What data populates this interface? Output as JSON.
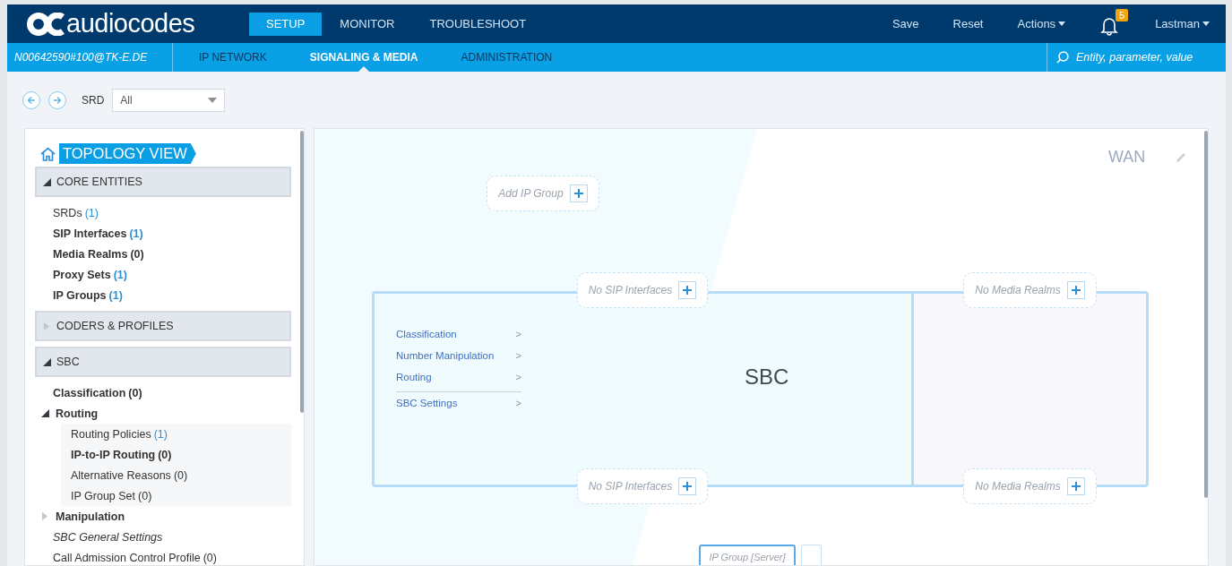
{
  "brand": {
    "name": "audiocodes"
  },
  "top_tabs": [
    {
      "label": "SETUP",
      "selected": true
    },
    {
      "label": "MONITOR",
      "selected": false
    },
    {
      "label": "TROUBLESHOOT",
      "selected": false
    }
  ],
  "top_actions": [
    {
      "label": "Save",
      "kind": "plain"
    },
    {
      "label": "Reset",
      "kind": "plain"
    },
    {
      "label": "Actions",
      "kind": "menu"
    }
  ],
  "notifications": {
    "count": "5"
  },
  "user": {
    "label": "Lastman"
  },
  "device": "N00642590#100@TK-E.DE",
  "sub_tabs": [
    {
      "label": "IP NETWORK",
      "selected": false
    },
    {
      "label": "SIGNALING & MEDIA",
      "selected": true
    },
    {
      "label": "ADMINISTRATION",
      "selected": false
    }
  ],
  "search": {
    "placeholder": "Entity, parameter, value"
  },
  "srd_filter": {
    "label": "SRD",
    "value": "All"
  },
  "sidebar": {
    "title": "TOPOLOGY VIEW",
    "sections": [
      {
        "title": "CORE ENTITIES",
        "expanded": true,
        "items": [
          {
            "label": "SRDs",
            "count": "(1)",
            "count_highlighted": true,
            "bold": false,
            "italic": false
          },
          {
            "label": "SIP Interfaces",
            "count": "(1)",
            "count_highlighted": true,
            "bold": true,
            "italic": false
          },
          {
            "label": "Media Realms",
            "count": "(0)",
            "count_highlighted": false,
            "bold": true,
            "italic": false
          },
          {
            "label": "Proxy Sets",
            "count": "(1)",
            "count_highlighted": true,
            "bold": true,
            "italic": false
          },
          {
            "label": "IP Groups",
            "count": "(1)",
            "count_highlighted": true,
            "bold": true,
            "italic": false
          }
        ]
      },
      {
        "title": "CODERS & PROFILES",
        "expanded": false
      },
      {
        "title": "SBC",
        "expanded": true,
        "items": [
          {
            "label": "Classification",
            "count": "(0)",
            "count_highlighted": false,
            "bold": true,
            "italic": false
          },
          {
            "label": "Routing",
            "bold": true,
            "italic": false,
            "expanded": true,
            "children": [
              {
                "label": "Routing Policies",
                "count": "(1)",
                "count_highlighted": true,
                "bold": false,
                "italic": false
              },
              {
                "label": "IP-to-IP Routing",
                "count": "(0)",
                "count_highlighted": false,
                "bold": true,
                "italic": false
              },
              {
                "label": "Alternative Reasons",
                "count": "(0)",
                "count_highlighted": false,
                "bold": false,
                "italic": false
              },
              {
                "label": "IP Group Set",
                "count": "(0)",
                "count_highlighted": false,
                "bold": false,
                "italic": false
              }
            ]
          },
          {
            "label": "Manipulation",
            "bold": true,
            "italic": false,
            "expanded": false
          },
          {
            "label": "SBC General Settings",
            "bold": false,
            "italic": true
          },
          {
            "label": "Call Admission Control Profile",
            "count": "(0)",
            "count_highlighted": false,
            "bold": false,
            "italic": false
          }
        ]
      }
    ]
  },
  "topology": {
    "zone": "WAN",
    "add_ip_group": "Add IP Group",
    "sbc": {
      "title": "SBC",
      "menu": [
        {
          "label": "Classification",
          "arrow": ">",
          "separated": false
        },
        {
          "label": "Number Manipulation",
          "arrow": ">",
          "separated": false
        },
        {
          "label": "Routing",
          "arrow": ">",
          "separated": false
        },
        {
          "label": "SBC Settings",
          "arrow": ">",
          "separated": true
        }
      ]
    },
    "top_slots": [
      {
        "label": "No SIP Interfaces",
        "kind": "sip"
      },
      {
        "label": "No Media Realms",
        "kind": "media"
      }
    ],
    "bottom_slots": [
      {
        "label": "No SIP Interfaces",
        "kind": "sip"
      },
      {
        "label": "No Media Realms",
        "kind": "media"
      }
    ],
    "ip_group": "IP Group [Server]"
  }
}
